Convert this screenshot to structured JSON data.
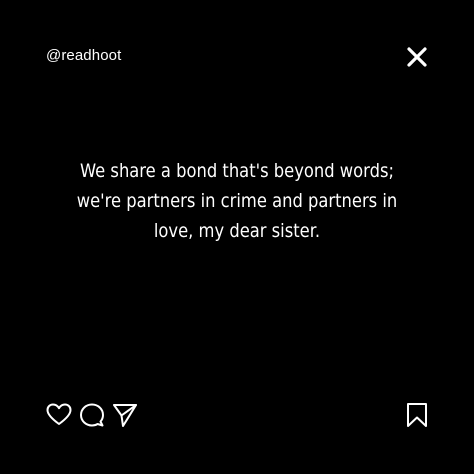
{
  "post": {
    "handle": "@readhoot",
    "quote_lines": [
      "We share a bond that's beyond words;",
      "we're partners in crime and partners in",
      "love, my dear sister."
    ]
  },
  "icons": {
    "close": "close-icon",
    "like": "heart-icon",
    "comment": "comment-bubble-icon",
    "share": "send-icon",
    "save": "bookmark-icon"
  },
  "colors": {
    "background": "#000000",
    "foreground": "#ffffff"
  }
}
